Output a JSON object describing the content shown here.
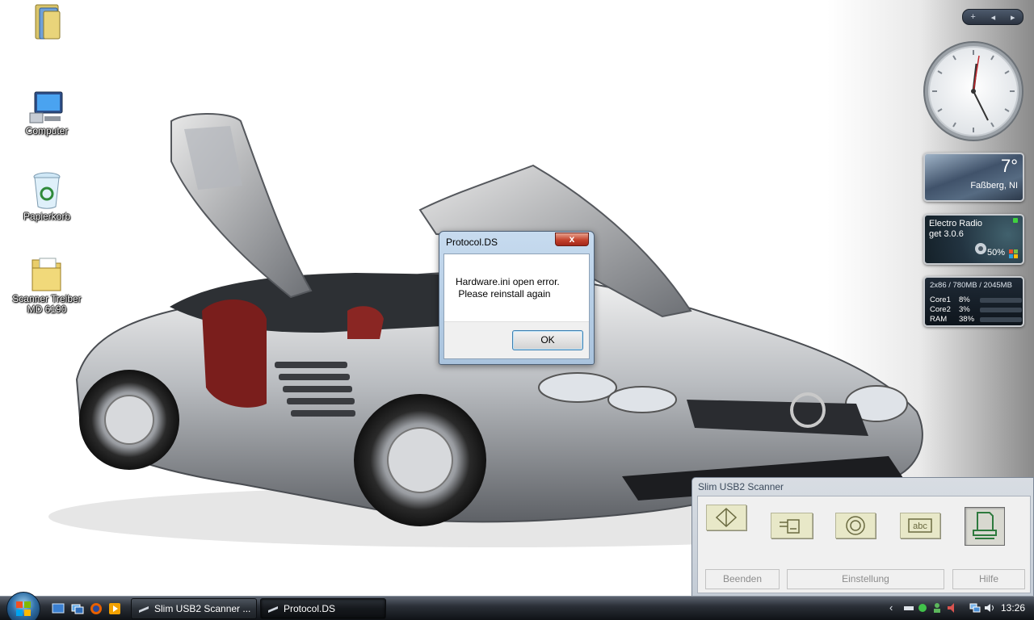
{
  "desktop": {
    "icons": [
      {
        "label": "",
        "icon": "folder-stack-icon"
      },
      {
        "label": "Computer",
        "icon": "computer-icon"
      },
      {
        "label": "Papierkorb",
        "icon": "recycle-bin-icon"
      },
      {
        "label": "Scanner Treiber MD 6190",
        "icon": "folder-icon"
      }
    ]
  },
  "gadgets": {
    "toolbar": {
      "add": "+",
      "prev": "◂",
      "next": "▸"
    },
    "weather": {
      "temperature": "7°",
      "location": "Faßberg, NI"
    },
    "radio": {
      "line1": "Electro Radio",
      "line2": "get 3.0.6",
      "volume": "50%"
    },
    "system": {
      "header": "2x86 / 780MB / 2045MB",
      "rows": [
        {
          "name": "Core1",
          "value": "8%",
          "level": 0.08
        },
        {
          "name": "Core2",
          "value": "3%",
          "level": 0.03
        },
        {
          "name": "RAM",
          "value": "38%",
          "level": 0.38
        }
      ]
    }
  },
  "dialog": {
    "title": "Protocol.DS",
    "close": "x",
    "message_line1": "Hardware.ini open error.",
    "message_line2": " Please reinstall again",
    "ok": "OK"
  },
  "scanner": {
    "title": "Slim USB2 Scanner",
    "buttons": {
      "quit": "Beenden",
      "settings": "Einstellung",
      "help": "Hilfe"
    }
  },
  "taskbar": {
    "tasks": [
      {
        "label": "Slim USB2 Scanner ..."
      },
      {
        "label": "Protocol.DS"
      }
    ],
    "tray_chevron": "‹",
    "clock": "13:26"
  }
}
